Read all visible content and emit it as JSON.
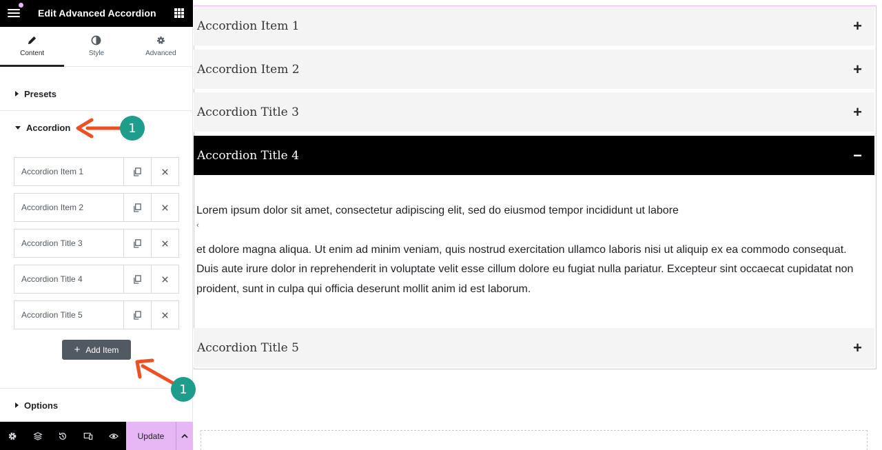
{
  "panel": {
    "title": "Edit Advanced Accordion",
    "tabs": [
      {
        "label": "Content",
        "icon": "pencil-icon"
      },
      {
        "label": "Style",
        "icon": "contrast-icon"
      },
      {
        "label": "Advanced",
        "icon": "gear-icon"
      }
    ],
    "sections": {
      "presets": "Presets",
      "accordion": "Accordion",
      "options": "Options"
    },
    "repeater_items": [
      "Accordion Item 1",
      "Accordion Item 2",
      "Accordion Title 3",
      "Accordion Title 4",
      "Accordion Title 5"
    ],
    "add_item_label": "Add Item",
    "footer": {
      "update_label": "Update",
      "icons": [
        "gear-icon",
        "layers-icon",
        "history-icon",
        "responsive-icon",
        "eye-icon"
      ]
    }
  },
  "annotations": {
    "badge_1": "1",
    "badge_2": "1",
    "arrow_color": "#f04e23",
    "badge_color": "#1f9d8c"
  },
  "accordion": {
    "items": [
      {
        "title": "Accordion Item 1",
        "icon": "+"
      },
      {
        "title": "Accordion Item 2",
        "icon": "+"
      },
      {
        "title": "Accordion Title 3",
        "icon": "+"
      },
      {
        "title": "Accordion Title 4",
        "icon": "−"
      },
      {
        "title": "Accordion Title 5",
        "icon": "+"
      }
    ],
    "open_body": [
      "Lorem ipsum dolor sit amet, consectetur adipiscing elit, sed do eiusmod tempor incididunt ut labore",
      "et dolore magna aliqua. Ut enim ad minim veniam, quis nostrud exercitation ullamco laboris nisi ut aliquip ex ea commodo consequat. Duis aute irure dolor in reprehenderit in voluptate velit esse cillum dolore eu fugiat nulla pariatur. Excepteur sint occaecat cupidatat non proident, sunt in culpa qui officia deserunt mollit anim id est laborum."
    ]
  },
  "colors": {
    "accent_pink": "#e7b6f4",
    "dark": "#000000",
    "button_gray": "#515962"
  }
}
